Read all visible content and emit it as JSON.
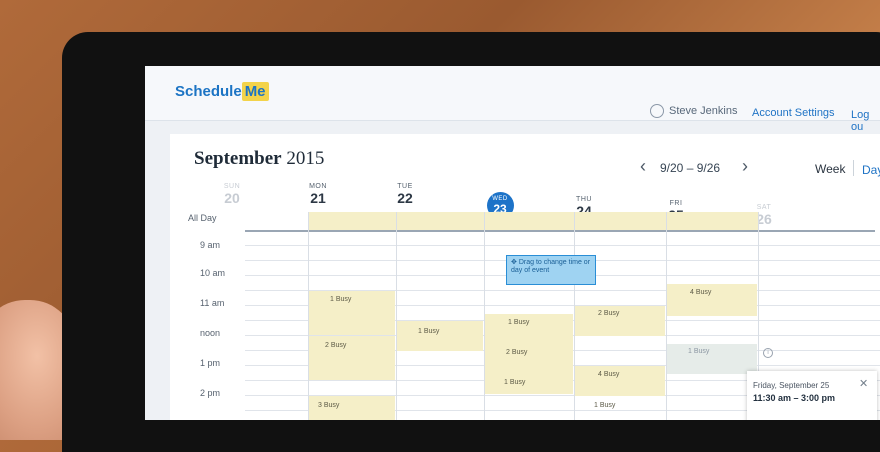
{
  "app": {
    "logo_text": "Schedule",
    "logo_badge": "Me"
  },
  "header": {
    "user_name": "Steve Jenkins",
    "account_settings": "Account Settings",
    "logout": "Log ou"
  },
  "calendar": {
    "month": "September",
    "year": "2015",
    "range": "9/20 – 9/26",
    "view_week": "Week",
    "view_day": "Day",
    "all_day_label": "All Day",
    "days": [
      {
        "dow": "SUN",
        "num": "20"
      },
      {
        "dow": "MON",
        "num": "21"
      },
      {
        "dow": "TUE",
        "num": "22"
      },
      {
        "dow": "WED",
        "num": "23"
      },
      {
        "dow": "THU",
        "num": "24"
      },
      {
        "dow": "FRI",
        "num": "25"
      },
      {
        "dow": "SAT",
        "num": "26"
      }
    ],
    "times": [
      "9 am",
      "10 am",
      "11 am",
      "noon",
      "1 pm",
      "2 pm"
    ],
    "busy": {
      "mon_11": "1 Busy",
      "mon_12": "2 Busy",
      "mon_2": "3 Busy",
      "tue_12": "1 Busy",
      "wed_1130": "1 Busy",
      "wed_1230": "2 Busy",
      "wed_130": "1 Busy",
      "thu_1130": "2 Busy",
      "thu_130": "4 Busy",
      "thu_230": "1 Busy",
      "fri_1030": "4 Busy",
      "fri_1230": "1 Busy"
    },
    "drag_event": "Drag to change time or day of event",
    "popup": {
      "date": "Friday, September 25",
      "time": "11:30 am – 3:00 pm"
    }
  },
  "colors": {
    "accent": "#1d73c8",
    "busy_shade": "#f5efc8",
    "event_fill": "#9fd3f2"
  }
}
